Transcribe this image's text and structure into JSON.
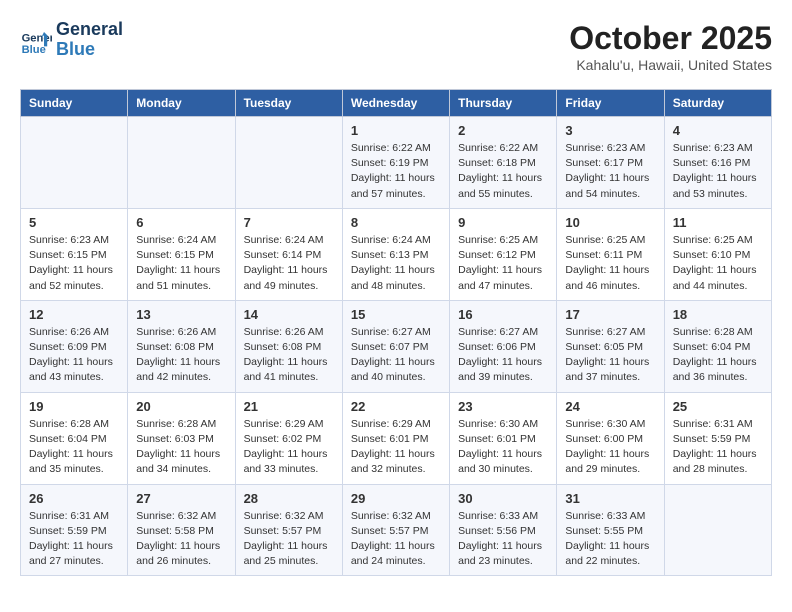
{
  "header": {
    "logo_line1": "General",
    "logo_line2": "Blue",
    "month_title": "October 2025",
    "location": "Kahalu'u, Hawaii, United States"
  },
  "weekdays": [
    "Sunday",
    "Monday",
    "Tuesday",
    "Wednesday",
    "Thursday",
    "Friday",
    "Saturday"
  ],
  "weeks": [
    [
      {
        "day": "",
        "info": ""
      },
      {
        "day": "",
        "info": ""
      },
      {
        "day": "",
        "info": ""
      },
      {
        "day": "1",
        "info": "Sunrise: 6:22 AM\nSunset: 6:19 PM\nDaylight: 11 hours\nand 57 minutes."
      },
      {
        "day": "2",
        "info": "Sunrise: 6:22 AM\nSunset: 6:18 PM\nDaylight: 11 hours\nand 55 minutes."
      },
      {
        "day": "3",
        "info": "Sunrise: 6:23 AM\nSunset: 6:17 PM\nDaylight: 11 hours\nand 54 minutes."
      },
      {
        "day": "4",
        "info": "Sunrise: 6:23 AM\nSunset: 6:16 PM\nDaylight: 11 hours\nand 53 minutes."
      }
    ],
    [
      {
        "day": "5",
        "info": "Sunrise: 6:23 AM\nSunset: 6:15 PM\nDaylight: 11 hours\nand 52 minutes."
      },
      {
        "day": "6",
        "info": "Sunrise: 6:24 AM\nSunset: 6:15 PM\nDaylight: 11 hours\nand 51 minutes."
      },
      {
        "day": "7",
        "info": "Sunrise: 6:24 AM\nSunset: 6:14 PM\nDaylight: 11 hours\nand 49 minutes."
      },
      {
        "day": "8",
        "info": "Sunrise: 6:24 AM\nSunset: 6:13 PM\nDaylight: 11 hours\nand 48 minutes."
      },
      {
        "day": "9",
        "info": "Sunrise: 6:25 AM\nSunset: 6:12 PM\nDaylight: 11 hours\nand 47 minutes."
      },
      {
        "day": "10",
        "info": "Sunrise: 6:25 AM\nSunset: 6:11 PM\nDaylight: 11 hours\nand 46 minutes."
      },
      {
        "day": "11",
        "info": "Sunrise: 6:25 AM\nSunset: 6:10 PM\nDaylight: 11 hours\nand 44 minutes."
      }
    ],
    [
      {
        "day": "12",
        "info": "Sunrise: 6:26 AM\nSunset: 6:09 PM\nDaylight: 11 hours\nand 43 minutes."
      },
      {
        "day": "13",
        "info": "Sunrise: 6:26 AM\nSunset: 6:08 PM\nDaylight: 11 hours\nand 42 minutes."
      },
      {
        "day": "14",
        "info": "Sunrise: 6:26 AM\nSunset: 6:08 PM\nDaylight: 11 hours\nand 41 minutes."
      },
      {
        "day": "15",
        "info": "Sunrise: 6:27 AM\nSunset: 6:07 PM\nDaylight: 11 hours\nand 40 minutes."
      },
      {
        "day": "16",
        "info": "Sunrise: 6:27 AM\nSunset: 6:06 PM\nDaylight: 11 hours\nand 39 minutes."
      },
      {
        "day": "17",
        "info": "Sunrise: 6:27 AM\nSunset: 6:05 PM\nDaylight: 11 hours\nand 37 minutes."
      },
      {
        "day": "18",
        "info": "Sunrise: 6:28 AM\nSunset: 6:04 PM\nDaylight: 11 hours\nand 36 minutes."
      }
    ],
    [
      {
        "day": "19",
        "info": "Sunrise: 6:28 AM\nSunset: 6:04 PM\nDaylight: 11 hours\nand 35 minutes."
      },
      {
        "day": "20",
        "info": "Sunrise: 6:28 AM\nSunset: 6:03 PM\nDaylight: 11 hours\nand 34 minutes."
      },
      {
        "day": "21",
        "info": "Sunrise: 6:29 AM\nSunset: 6:02 PM\nDaylight: 11 hours\nand 33 minutes."
      },
      {
        "day": "22",
        "info": "Sunrise: 6:29 AM\nSunset: 6:01 PM\nDaylight: 11 hours\nand 32 minutes."
      },
      {
        "day": "23",
        "info": "Sunrise: 6:30 AM\nSunset: 6:01 PM\nDaylight: 11 hours\nand 30 minutes."
      },
      {
        "day": "24",
        "info": "Sunrise: 6:30 AM\nSunset: 6:00 PM\nDaylight: 11 hours\nand 29 minutes."
      },
      {
        "day": "25",
        "info": "Sunrise: 6:31 AM\nSunset: 5:59 PM\nDaylight: 11 hours\nand 28 minutes."
      }
    ],
    [
      {
        "day": "26",
        "info": "Sunrise: 6:31 AM\nSunset: 5:59 PM\nDaylight: 11 hours\nand 27 minutes."
      },
      {
        "day": "27",
        "info": "Sunrise: 6:32 AM\nSunset: 5:58 PM\nDaylight: 11 hours\nand 26 minutes."
      },
      {
        "day": "28",
        "info": "Sunrise: 6:32 AM\nSunset: 5:57 PM\nDaylight: 11 hours\nand 25 minutes."
      },
      {
        "day": "29",
        "info": "Sunrise: 6:32 AM\nSunset: 5:57 PM\nDaylight: 11 hours\nand 24 minutes."
      },
      {
        "day": "30",
        "info": "Sunrise: 6:33 AM\nSunset: 5:56 PM\nDaylight: 11 hours\nand 23 minutes."
      },
      {
        "day": "31",
        "info": "Sunrise: 6:33 AM\nSunset: 5:55 PM\nDaylight: 11 hours\nand 22 minutes."
      },
      {
        "day": "",
        "info": ""
      }
    ]
  ]
}
